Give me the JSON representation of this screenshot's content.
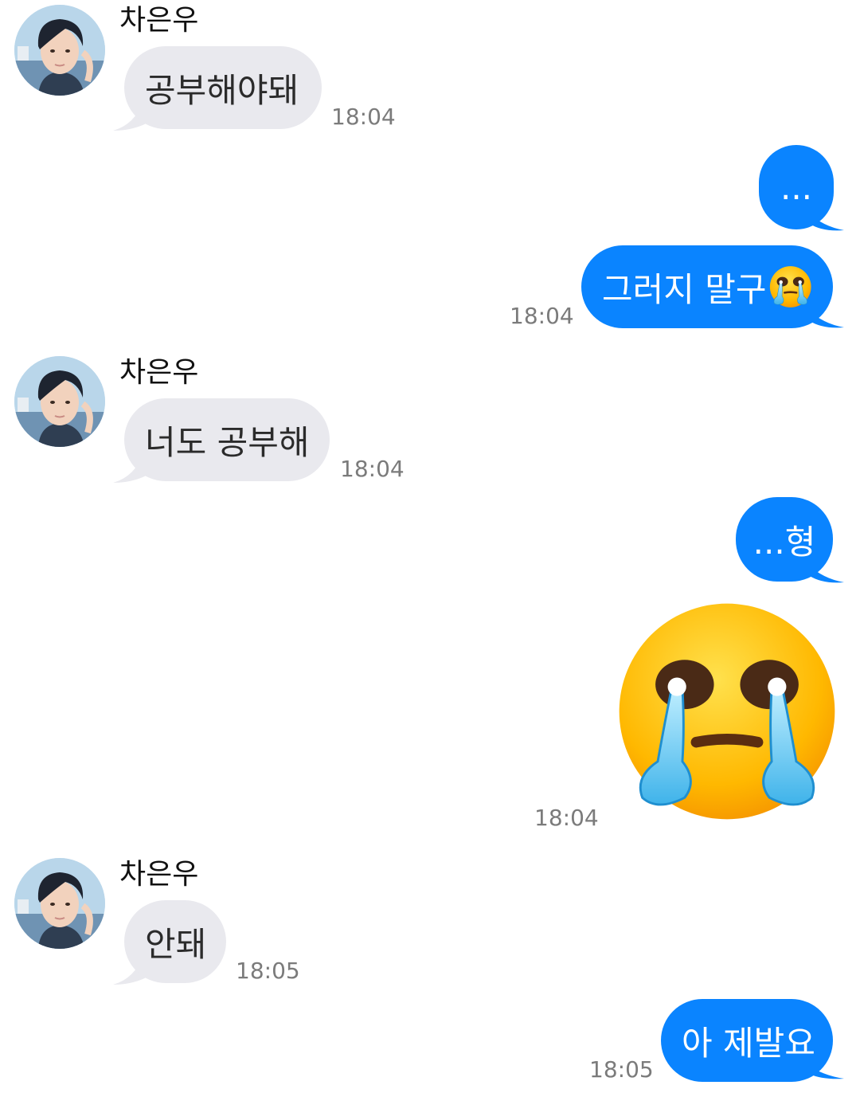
{
  "contact": {
    "name": "차은우"
  },
  "colors": {
    "incoming_bubble": "#e9e9ee",
    "outgoing_bubble": "#0a84ff",
    "timestamp": "#7b7b7b"
  },
  "messages": [
    {
      "side": "in",
      "text": "공부해야돼",
      "time": "18:04"
    },
    {
      "side": "out",
      "text": "...",
      "time": ""
    },
    {
      "side": "out",
      "text": "그러지 말구",
      "emoji": "crying-face-emoji",
      "time": "18:04"
    },
    {
      "side": "in",
      "text": "너도 공부해",
      "time": "18:04"
    },
    {
      "side": "out",
      "text": "...형",
      "time": ""
    },
    {
      "side": "out",
      "sticker": "crying-face-sticker",
      "time": "18:04"
    },
    {
      "side": "in",
      "text": "안돼",
      "time": "18:05"
    },
    {
      "side": "out",
      "text": "아 제발요",
      "time": "18:05"
    }
  ]
}
